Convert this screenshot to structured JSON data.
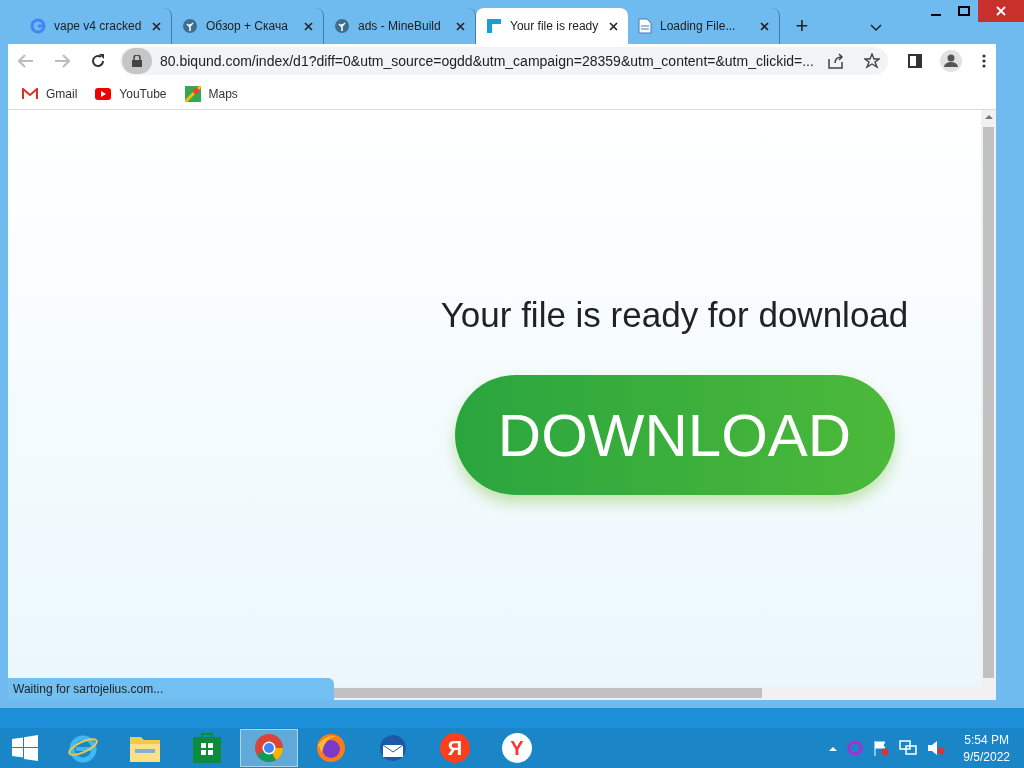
{
  "tabs": [
    {
      "title": "vape v4 cracked",
      "kind": "google",
      "selected": false
    },
    {
      "title": "Обзор + Скача",
      "kind": "leaf",
      "selected": false
    },
    {
      "title": "ads - MineBuild",
      "kind": "leaf",
      "selected": false
    },
    {
      "title": "Your file is ready",
      "kind": "square",
      "selected": true
    },
    {
      "title": "Loading File...",
      "kind": "doc",
      "selected": false
    }
  ],
  "new_tab": "+",
  "address": {
    "url": "80.biqund.com/index/d1?diff=0&utm_source=ogdd&utm_campaign=28359&utm_content=&utm_clickid=..."
  },
  "bookmarks": [
    {
      "label": "Gmail",
      "kind": "gmail"
    },
    {
      "label": "YouTube",
      "kind": "youtube"
    },
    {
      "label": "Maps",
      "kind": "maps"
    }
  ],
  "page": {
    "heading": "Your file is ready for download",
    "button": "DOWNLOAD"
  },
  "status": "Waiting for sartojelius.com...",
  "taskbar": [
    {
      "kind": "ie",
      "selected": false
    },
    {
      "kind": "folder",
      "selected": false
    },
    {
      "kind": "store",
      "selected": false
    },
    {
      "kind": "chrome",
      "selected": true
    },
    {
      "kind": "firefox",
      "selected": false
    },
    {
      "kind": "mail",
      "selected": false
    },
    {
      "kind": "letter",
      "letter": "Я",
      "selected": false
    },
    {
      "kind": "yletter",
      "letter": "Y",
      "selected": false
    }
  ],
  "clock": {
    "time": "5:54 PM",
    "date": "9/5/2022"
  }
}
